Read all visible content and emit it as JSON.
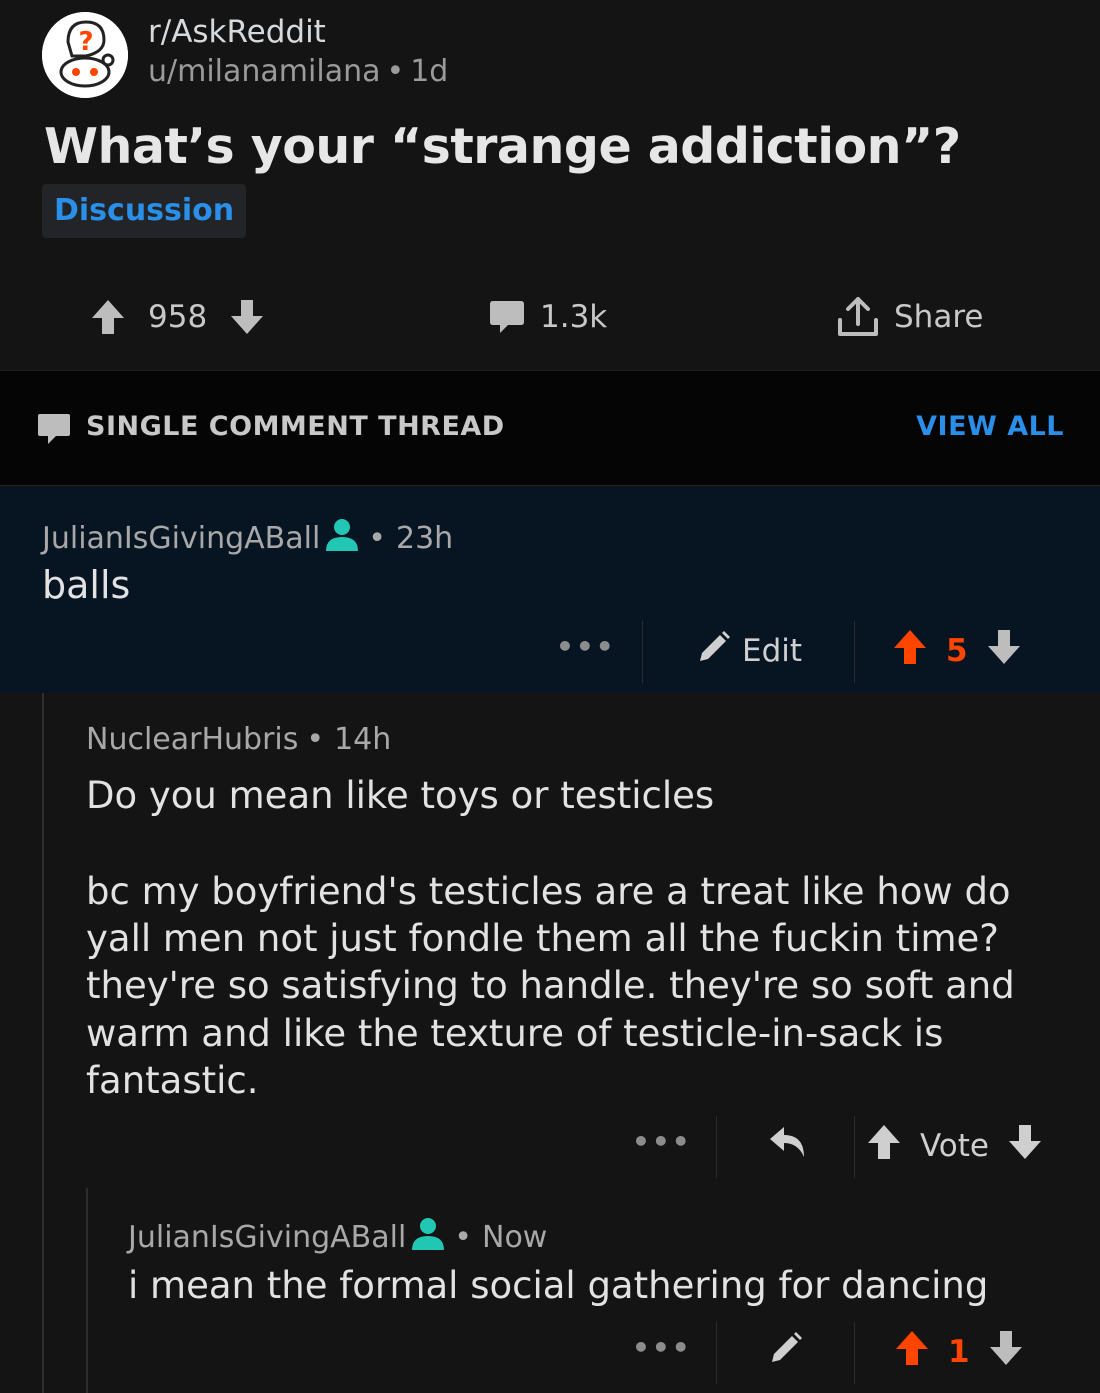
{
  "post": {
    "subreddit": "r/AskReddit",
    "author": "u/milanamilana",
    "age": "1d",
    "avatar_mark": "?",
    "title": "What’s your “strange addiction”?",
    "flair": "Discussion",
    "score": "958",
    "comments": "1.3k",
    "share_label": "Share",
    "colors": {
      "flair": "#2a8fe8",
      "background": "#141414"
    }
  },
  "thread_bar": {
    "label": "SINGLE COMMENT THREAD",
    "view_all": "VIEW ALL"
  },
  "comments": [
    {
      "author": "JulianIsGivingABall",
      "age": "23h",
      "body": "balls",
      "more": "•••",
      "edit_label": "Edit",
      "score": "5",
      "upvoted": true,
      "highlighted": true
    },
    {
      "author": "NuclearHubris",
      "age": "14h",
      "body_lines": [
        "Do you mean like toys or testicles",
        "",
        "bc my boyfriend's testicles are a treat like how do",
        "yall men not just fondle them all the fuckin time?",
        "they're so satisfying to handle. they're so soft and",
        "warm and like the texture of testicle-in-sack is",
        "fantastic."
      ],
      "more": "•••",
      "vote_label": "Vote"
    },
    {
      "author": "JulianIsGivingABall",
      "age": "Now",
      "body": "i mean the formal social gathering for dancing",
      "more": "•••",
      "score": "1",
      "upvoted": true
    }
  ],
  "colors": {
    "upvote": "#ff4500",
    "op_badge": "#21c7b3",
    "link": "#2a8fe8"
  },
  "icons": [
    "upvote-icon",
    "downvote-icon",
    "comment-icon",
    "share-icon",
    "user-icon",
    "pencil-icon",
    "reply-icon"
  ]
}
